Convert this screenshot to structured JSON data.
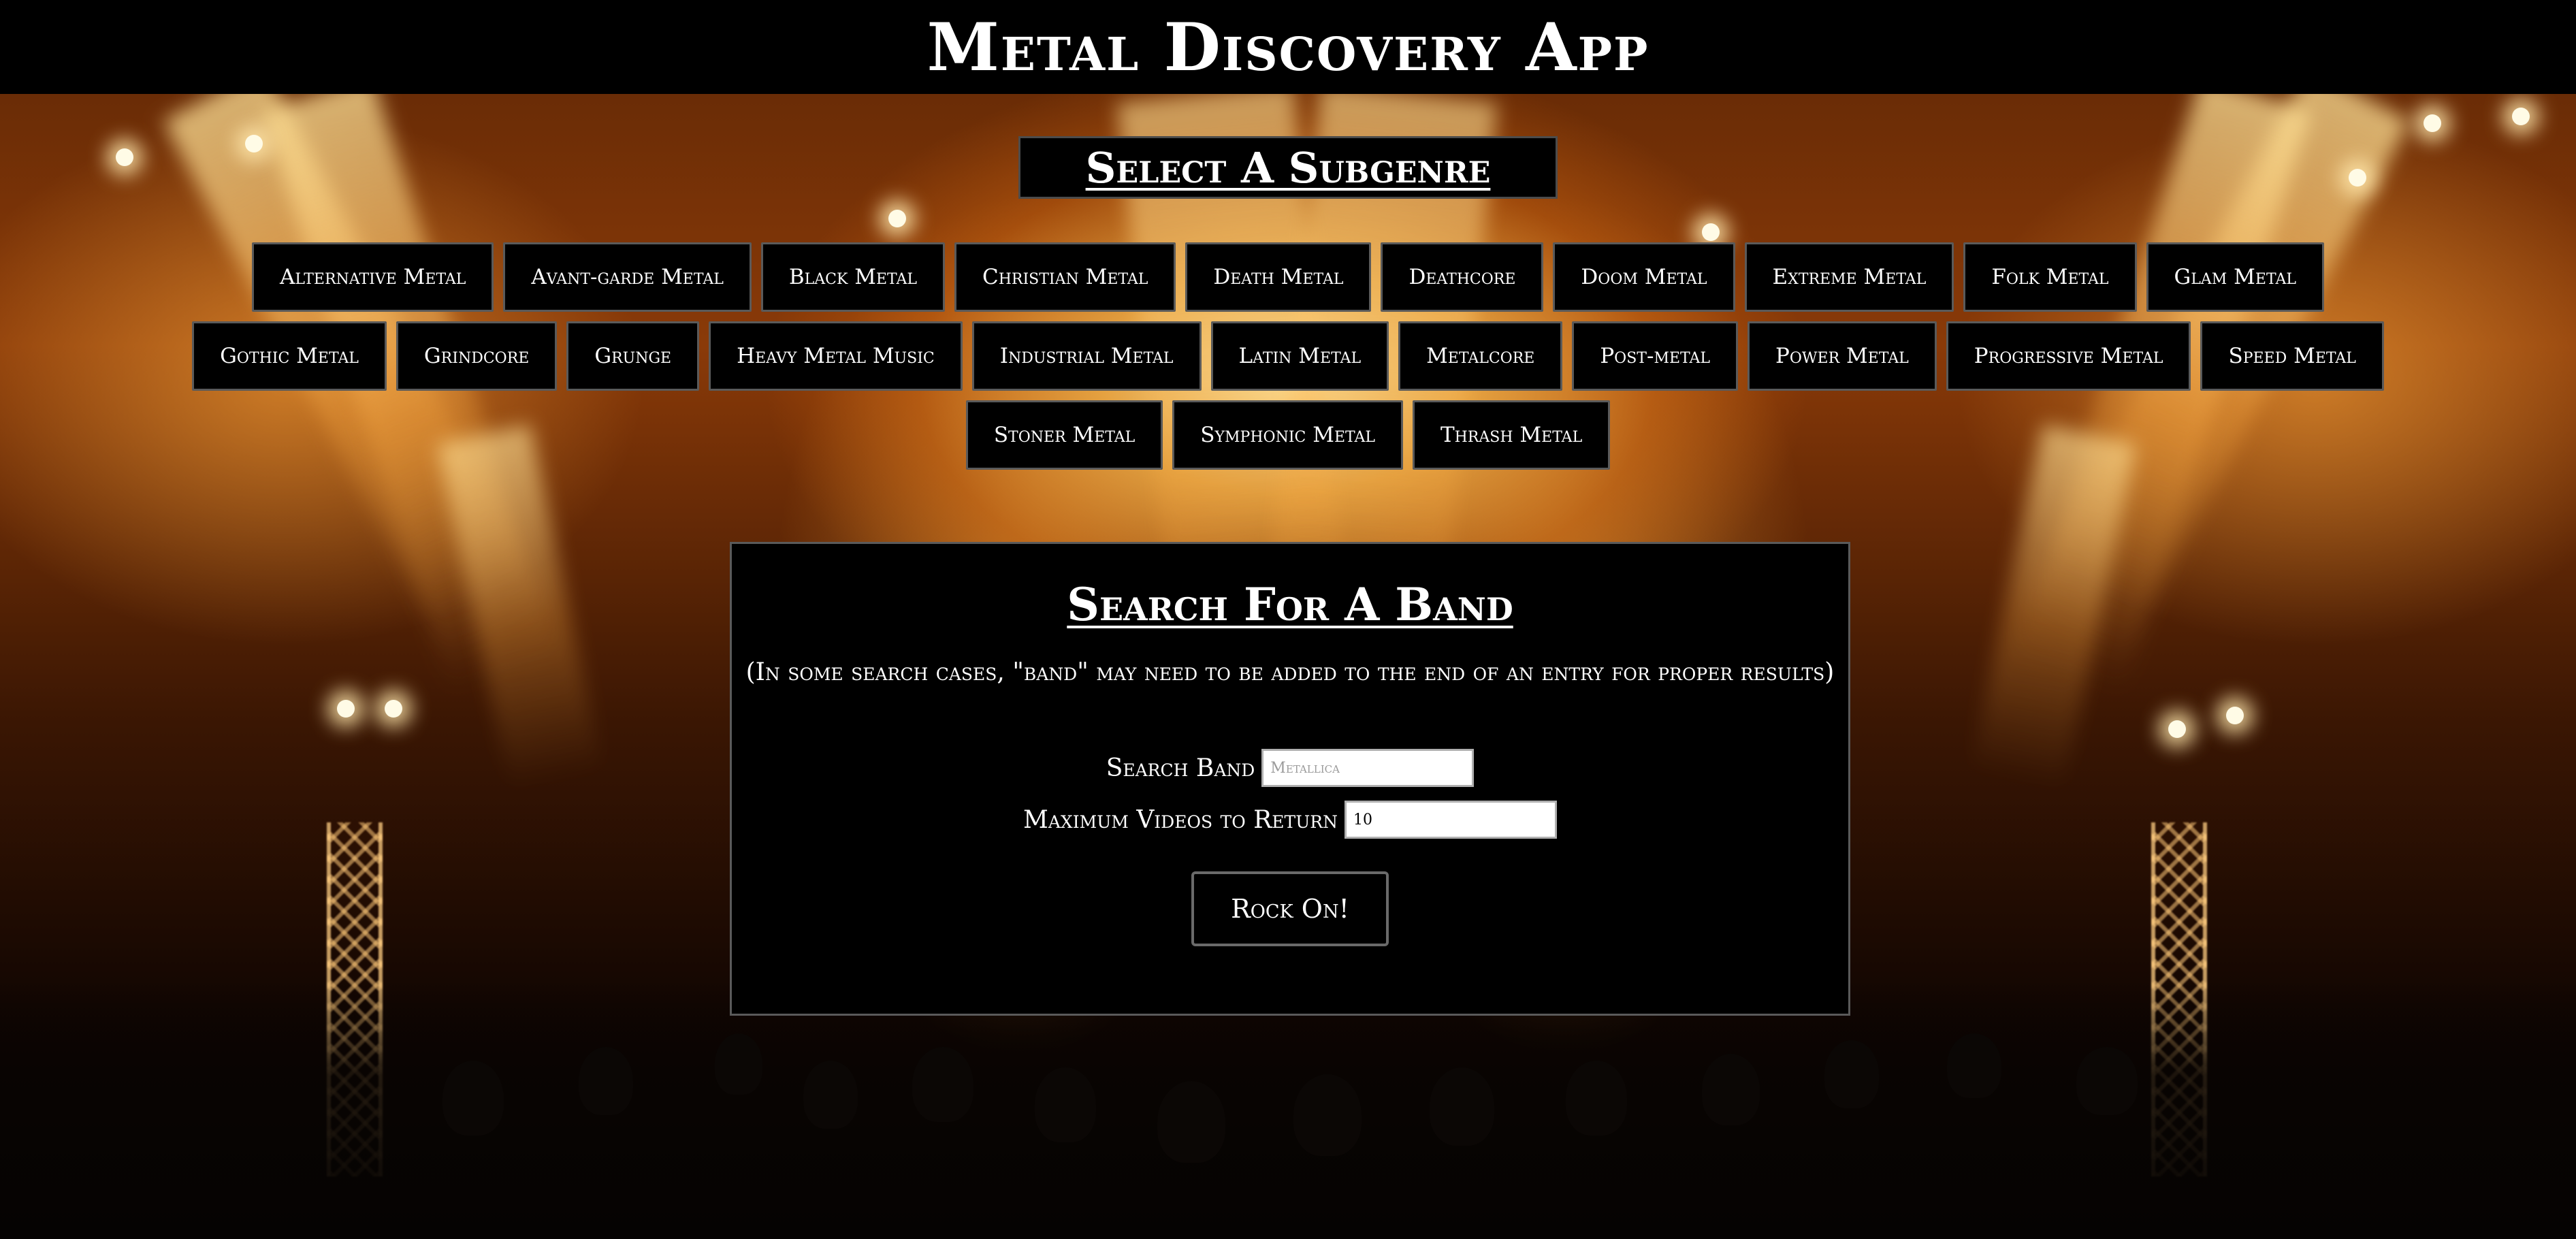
{
  "header": {
    "title": "Metal Discovery App"
  },
  "subgenres": {
    "title": "Select A Subgenre",
    "rows": [
      [
        "Alternative Metal",
        "Avant-garde Metal",
        "Black Metal",
        "Christian Metal",
        "Death Metal",
        "Deathcore",
        "Doom Metal",
        "Extreme Metal",
        "Folk Metal",
        "Glam Metal"
      ],
      [
        "Gothic Metal",
        "Grindcore",
        "Grunge",
        "Heavy Metal Music",
        "Industrial Metal",
        "Latin Metal",
        "Metalcore",
        "Post-metal",
        "Power Metal",
        "Progressive Metal",
        "Speed Metal"
      ],
      [
        "Stoner Metal",
        "Symphonic Metal",
        "Thrash Metal"
      ]
    ]
  },
  "search": {
    "title": "Search For A Band",
    "note": "(In some search cases, \"band\" may need to be added to the end of an entry for proper results)",
    "band_label": "Search Band",
    "band_placeholder": "Metallica",
    "max_label": "Maximum Videos to Return",
    "max_value": "10",
    "submit_label": "Rock On!"
  }
}
